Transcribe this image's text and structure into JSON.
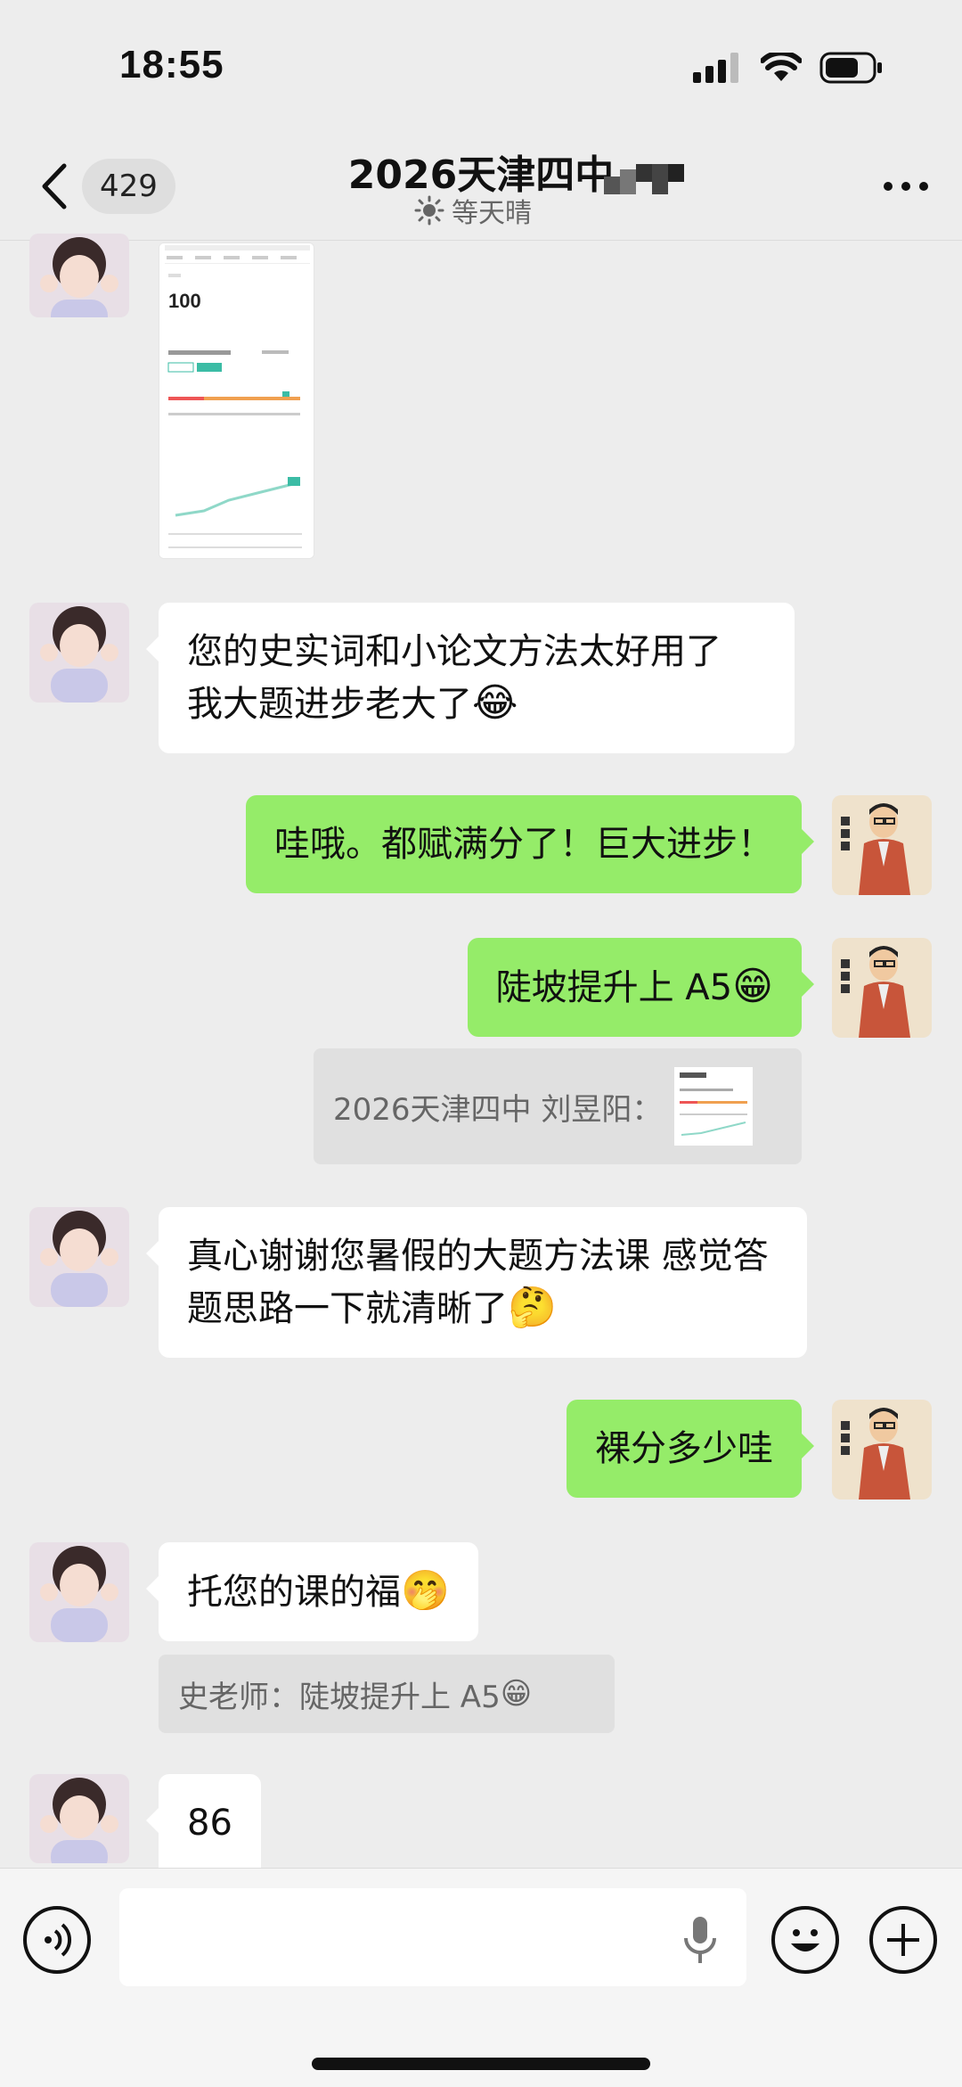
{
  "status_bar": {
    "time": "18:55",
    "icons": [
      "signal-icon",
      "wifi-icon",
      "battery-icon"
    ]
  },
  "header": {
    "back_icon": "chevron-left-icon",
    "unread_count": "429",
    "title": "2026天津四中",
    "status_text": "等天晴",
    "status_icon": "sun-icon",
    "more_icon": "more-icon"
  },
  "messages": [
    {
      "id": "m1",
      "side": "in",
      "type": "image",
      "screenshot_score": "100"
    },
    {
      "id": "m2",
      "side": "in",
      "text": "您的史实词和小论文方法太好用了 我大题进步老大了",
      "emoji": "😂"
    },
    {
      "id": "m3",
      "side": "out",
      "text": "哇哦。都赋满分了！巨大进步！"
    },
    {
      "id": "m4",
      "side": "out",
      "text": "陡坡提升上 A5",
      "emoji": "😁",
      "quote": "2026天津四中 刘昱阳："
    },
    {
      "id": "m5",
      "side": "in",
      "text": "真心谢谢您暑假的大题方法课 感觉答题思路一下就清晰了",
      "emoji": "🤔"
    },
    {
      "id": "m6",
      "side": "out",
      "text": "裸分多少哇"
    },
    {
      "id": "m7",
      "side": "in",
      "text": "托您的课的福",
      "emoji": "🤭",
      "quote": "史老师：陡坡提升上 A5",
      "quote_emoji": "😁"
    },
    {
      "id": "m8",
      "side": "in",
      "text": "86"
    }
  ],
  "teacher_avatar_text": "史老师",
  "input_bar": {
    "voice_icon": "voice-icon",
    "mic_icon": "mic-icon",
    "emoji_icon": "emoji-icon",
    "plus_icon": "plus-icon"
  },
  "colors": {
    "background": "#ededed",
    "bubble_in": "#ffffff",
    "bubble_out": "#95ec69",
    "quote_bg": "#e0e0e0",
    "accent_teal": "#3bbca5"
  }
}
